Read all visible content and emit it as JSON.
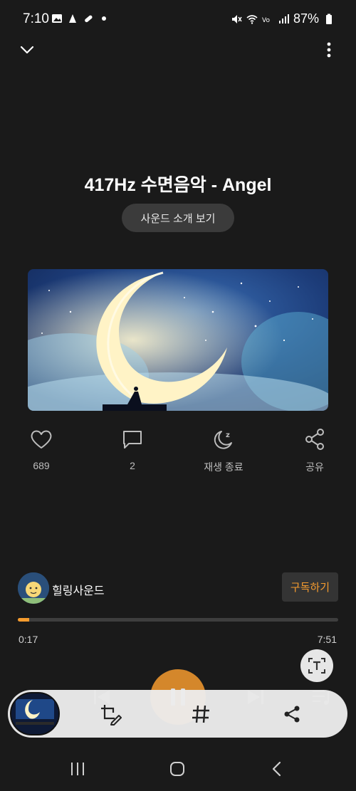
{
  "status_bar": {
    "time": "7:10",
    "battery": "87%",
    "icons_left": [
      "image-icon",
      "gallery-icon",
      "pill-icon",
      "dot-icon"
    ],
    "icons_right": [
      "mute-icon",
      "wifi-icon",
      "volte-icon",
      "signal-icon",
      "battery-icon"
    ]
  },
  "header": {
    "collapse_icon": "chevron-down-icon",
    "more_icon": "more-vertical-icon"
  },
  "track": {
    "title": "417Hz 수면음악 - Angel",
    "intro_button": "사운드 소개 보기"
  },
  "actions": {
    "like": {
      "icon": "heart-icon",
      "label": "689"
    },
    "comment": {
      "icon": "comment-icon",
      "label": "2"
    },
    "sleep_timer": {
      "icon": "moon-icon",
      "label": "재생 종료"
    },
    "share": {
      "icon": "share-icon",
      "label": "공유"
    }
  },
  "channel": {
    "name": "힐링사운드",
    "subscribe_button": "구독하기"
  },
  "player": {
    "elapsed": "0:17",
    "duration": "7:51",
    "progress_fraction": 0.036,
    "accent_color": "#f59b2e"
  },
  "floating_toolbar": {
    "buttons": [
      "crop-edit-icon",
      "hashtag-icon",
      "share-icon"
    ]
  },
  "nav": {
    "buttons": [
      "recents-icon",
      "home-icon",
      "back-icon"
    ]
  }
}
